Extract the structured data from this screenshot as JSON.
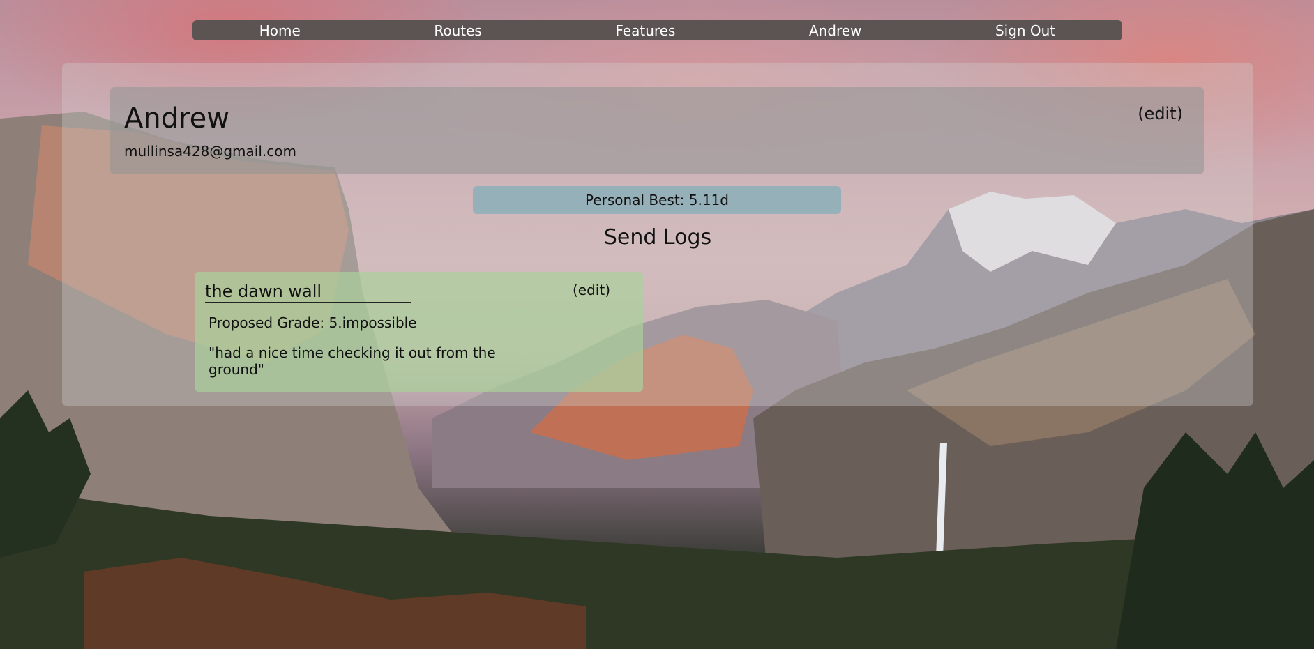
{
  "nav": {
    "items": [
      {
        "label": "Home"
      },
      {
        "label": "Routes"
      },
      {
        "label": "Features"
      },
      {
        "label": "Andrew"
      },
      {
        "label": "Sign Out"
      }
    ]
  },
  "profile": {
    "name": "Andrew",
    "email": "mullinsa428@gmail.com",
    "edit_label": "(edit)"
  },
  "personal_best": "Personal Best: 5.11d",
  "send_logs": {
    "title": "Send Logs",
    "entries": [
      {
        "route": "the dawn wall",
        "edit_label": "(edit)",
        "grade": "Proposed Grade: 5.impossible",
        "note": "\"had a nice time checking it out from the ground\""
      }
    ]
  },
  "colors": {
    "nav_bg": "#5b5452",
    "best_badge_bg": "#8cafb9",
    "log_card_bg": "#aad29b"
  }
}
